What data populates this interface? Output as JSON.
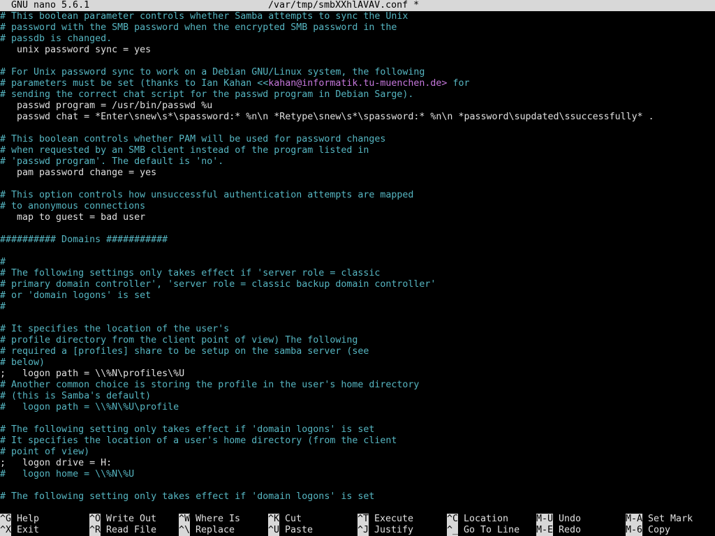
{
  "titlebar": {
    "app": "GNU nano 5.6.1",
    "file": "/var/tmp/smbXXhlAVAV.conf *"
  },
  "lines": [
    {
      "kind": "comment",
      "text": "# This boolean parameter controls whether Samba attempts to sync the Unix"
    },
    {
      "kind": "comment",
      "text": "# password with the SMB password when the encrypted SMB password in the"
    },
    {
      "kind": "comment",
      "text": "# passdb is changed."
    },
    {
      "kind": "text",
      "text": "   unix password sync = yes"
    },
    {
      "kind": "blank",
      "text": ""
    },
    {
      "kind": "comment",
      "text": "# For Unix password sync to work on a Debian GNU/Linux system, the following"
    },
    {
      "kind": "comment-email",
      "pre": "# parameters must be set (thanks to Ian Kahan <<",
      "email": "kahan@informatik.tu-muenchen.de>",
      "post": " for"
    },
    {
      "kind": "comment",
      "text": "# sending the correct chat script for the passwd program in Debian Sarge)."
    },
    {
      "kind": "text",
      "text": "   passwd program = /usr/bin/passwd %u"
    },
    {
      "kind": "text",
      "text": "   passwd chat = *Enter\\snew\\s*\\spassword:* %n\\n *Retype\\snew\\s*\\spassword:* %n\\n *password\\supdated\\ssuccessfully* ."
    },
    {
      "kind": "blank",
      "text": ""
    },
    {
      "kind": "comment",
      "text": "# This boolean controls whether PAM will be used for password changes"
    },
    {
      "kind": "comment",
      "text": "# when requested by an SMB client instead of the program listed in"
    },
    {
      "kind": "comment",
      "text": "# 'passwd program'. The default is 'no'."
    },
    {
      "kind": "text",
      "text": "   pam password change = yes"
    },
    {
      "kind": "blank",
      "text": ""
    },
    {
      "kind": "comment",
      "text": "# This option controls how unsuccessful authentication attempts are mapped"
    },
    {
      "kind": "comment",
      "text": "# to anonymous connections"
    },
    {
      "kind": "text",
      "text": "   map to guest = bad user"
    },
    {
      "kind": "blank",
      "text": ""
    },
    {
      "kind": "comment",
      "text": "########## Domains ###########"
    },
    {
      "kind": "blank",
      "text": ""
    },
    {
      "kind": "comment",
      "text": "#"
    },
    {
      "kind": "comment",
      "text": "# The following settings only takes effect if 'server role = classic"
    },
    {
      "kind": "comment",
      "text": "# primary domain controller', 'server role = classic backup domain controller'"
    },
    {
      "kind": "comment",
      "text": "# or 'domain logons' is set"
    },
    {
      "kind": "comment",
      "text": "#"
    },
    {
      "kind": "blank",
      "text": ""
    },
    {
      "kind": "comment",
      "text": "# It specifies the location of the user's"
    },
    {
      "kind": "comment",
      "text": "# profile directory from the client point of view) The following"
    },
    {
      "kind": "comment",
      "text": "# required a [profiles] share to be setup on the samba server (see"
    },
    {
      "kind": "comment",
      "text": "# below)"
    },
    {
      "kind": "text",
      "text": ";   logon path = \\\\%N\\profiles\\%U"
    },
    {
      "kind": "comment",
      "text": "# Another common choice is storing the profile in the user's home directory"
    },
    {
      "kind": "comment",
      "text": "# (this is Samba's default)"
    },
    {
      "kind": "comment",
      "text": "#   logon path = \\\\%N\\%U\\profile"
    },
    {
      "kind": "blank",
      "text": ""
    },
    {
      "kind": "comment",
      "text": "# The following setting only takes effect if 'domain logons' is set"
    },
    {
      "kind": "comment",
      "text": "# It specifies the location of a user's home directory (from the client"
    },
    {
      "kind": "comment",
      "text": "# point of view)"
    },
    {
      "kind": "text",
      "text": ";   logon drive = H:"
    },
    {
      "kind": "comment",
      "text": "#   logon home = \\\\%N\\%U"
    },
    {
      "kind": "blank",
      "text": ""
    },
    {
      "kind": "comment",
      "text": "# The following setting only takes effect if 'domain logons' is set"
    }
  ],
  "shortcuts": [
    {
      "key": "^G",
      "label": "Help"
    },
    {
      "key": "^X",
      "label": "Exit"
    },
    {
      "key": "^O",
      "label": "Write Out"
    },
    {
      "key": "^R",
      "label": "Read File"
    },
    {
      "key": "^W",
      "label": "Where Is"
    },
    {
      "key": "^\\",
      "label": "Replace"
    },
    {
      "key": "^K",
      "label": "Cut"
    },
    {
      "key": "^U",
      "label": "Paste"
    },
    {
      "key": "^T",
      "label": "Execute"
    },
    {
      "key": "^J",
      "label": "Justify"
    },
    {
      "key": "^C",
      "label": "Location"
    },
    {
      "key": "^_",
      "label": "Go To Line"
    },
    {
      "key": "M-U",
      "label": "Undo"
    },
    {
      "key": "M-E",
      "label": "Redo"
    },
    {
      "key": "M-A",
      "label": "Set Mark"
    },
    {
      "key": "M-6",
      "label": "Copy"
    }
  ]
}
